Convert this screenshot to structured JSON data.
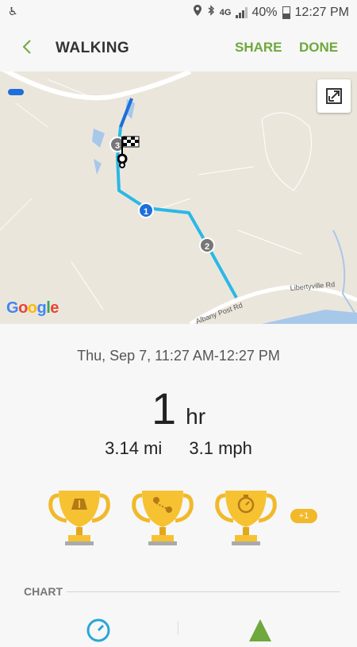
{
  "status_bar": {
    "network": "4G",
    "battery": "40%",
    "time": "12:27 PM",
    "icons": [
      "accessibility-icon",
      "location-icon",
      "bluetooth-icon",
      "signal-icon",
      "battery-icon"
    ]
  },
  "header": {
    "title": "WALKING",
    "share_label": "SHARE",
    "done_label": "DONE",
    "accent_color": "#6fa83d"
  },
  "map": {
    "markers": [
      "1",
      "2",
      "3"
    ],
    "road_labels": [
      "Albany Post Rd",
      "Libertyville Rd"
    ],
    "logo_text": "Google",
    "route_color": "#2ab8e6",
    "start_segment_color": "#1e6fd9"
  },
  "workout": {
    "date": "Thu, Sep 7, 11:27 AM-12:27 PM",
    "duration_value": "1",
    "duration_unit": "hr",
    "distance": "3.14 mi",
    "speed": "3.1 mph"
  },
  "trophies": {
    "icons": [
      "distance-trophy-icon",
      "route-trophy-icon",
      "timer-trophy-icon"
    ],
    "extra_count": "+1",
    "gold_color": "#f1b92a"
  },
  "chart_section": {
    "label": "CHART",
    "icons": [
      "speed-gauge-icon",
      "elevation-icon"
    ]
  }
}
